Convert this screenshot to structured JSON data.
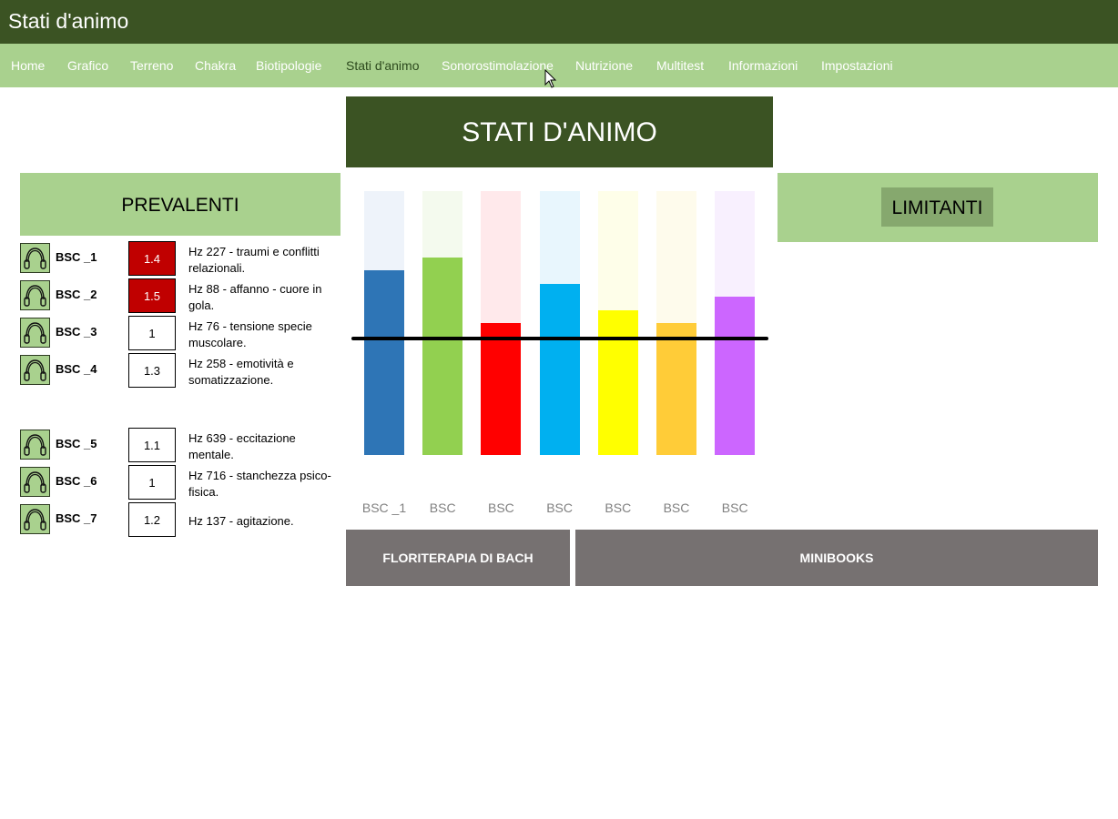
{
  "window": {
    "title": "Stati d'animo"
  },
  "nav": {
    "items": [
      {
        "label": "Home"
      },
      {
        "label": "Grafico"
      },
      {
        "label": "Terreno"
      },
      {
        "label": "Chakra"
      },
      {
        "label": "Biotipologie"
      },
      {
        "label": "Stati d'animo",
        "active": true
      },
      {
        "label": "Sonorostimolazione"
      },
      {
        "label": "Nutrizione"
      },
      {
        "label": "Multitest"
      },
      {
        "label": "Informazioni"
      },
      {
        "label": "Impostazioni"
      }
    ]
  },
  "header": {
    "title": "STATI D'ANIMO"
  },
  "prevalenti": {
    "title": "PREVALENTI",
    "rows": [
      {
        "code": "BSC _1",
        "value": "1.4",
        "desc": "Hz 227 - traumi e conflitti relazionali."
      },
      {
        "code": "BSC _2",
        "value": "1.5",
        "desc": "Hz 88 - affanno - cuore in gola."
      },
      {
        "code": "BSC _3",
        "value": "1",
        "desc": "Hz 76 - tensione specie muscolare."
      },
      {
        "code": "BSC _4",
        "value": "1.3",
        "desc": "Hz 258 - emotività e somatizzazione."
      },
      {
        "code": "BSC _5",
        "value": "1.1",
        "desc": "Hz 639 - eccitazione mentale."
      },
      {
        "code": "BSC _6",
        "value": "1",
        "desc": "Hz 716 - stanchezza psico-fisica."
      },
      {
        "code": "BSC _7",
        "value": "1.2",
        "desc": "Hz 137 - agitazione."
      }
    ]
  },
  "limitanti": {
    "title": "LIMITANTI"
  },
  "chart_data": {
    "type": "bar",
    "categories": [
      "BSC _1",
      "BSC",
      "BSC",
      "BSC",
      "BSC",
      "BSC",
      "BSC"
    ],
    "values": [
      0.7,
      0.75,
      0.5,
      0.65,
      0.55,
      0.5,
      0.6
    ],
    "colors": [
      "#2e75b6",
      "#92d050",
      "#ff0000",
      "#00b0f0",
      "#ffff00",
      "#ffcc38",
      "#cc66ff"
    ],
    "bg_colors": [
      "#eef3fa",
      "#f4faee",
      "#ffe9eb",
      "#e8f6fd",
      "#fefee9",
      "#fefbec",
      "#f8f0fe"
    ],
    "ylim": [
      0,
      1
    ],
    "threshold": 0.44
  },
  "buttons": {
    "floriterapia": "FLORITERAPIA DI BACH",
    "minibooks": "MINIBOOKS"
  }
}
